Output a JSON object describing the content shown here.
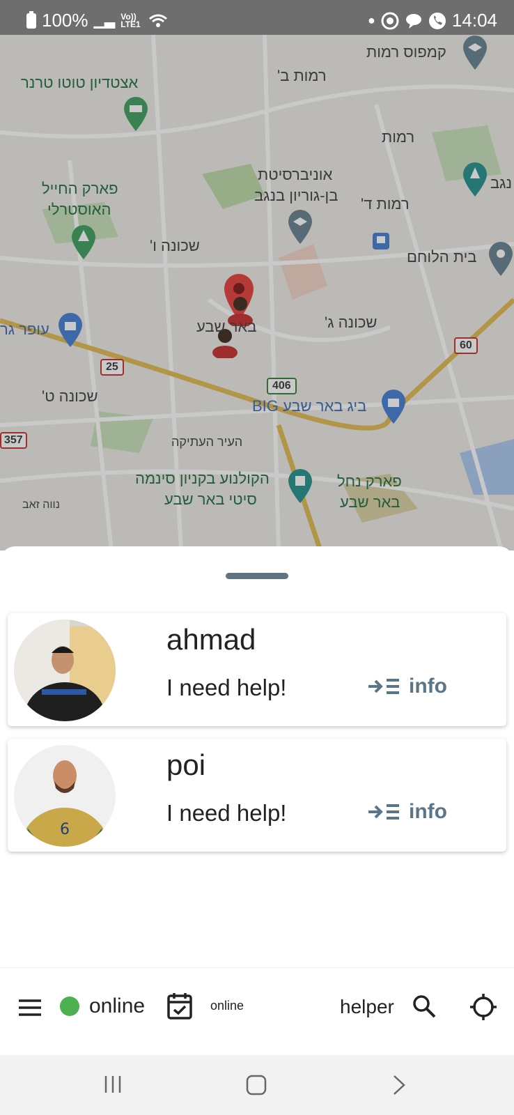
{
  "status_bar": {
    "battery": "100%",
    "signal": "Vo)) LTE1",
    "time": "14:04",
    "icons": [
      "battery-icon",
      "signal-icon",
      "wifi-icon",
      "whatsapp-icon",
      "chat-icon",
      "phone-icon"
    ]
  },
  "map": {
    "labels": [
      {
        "text": "קמפוס רמות",
        "kind": "normal"
      },
      {
        "text": "רמות ב'",
        "kind": "normal"
      },
      {
        "text": "אצטדיון טוטו טרנר",
        "kind": "green"
      },
      {
        "text": "רמות",
        "kind": "normal"
      },
      {
        "text": "אוניברסיטת",
        "kind": "normal"
      },
      {
        "text": "בן-גוריון בנגב",
        "kind": "normal"
      },
      {
        "text": "רמות ד'",
        "kind": "normal"
      },
      {
        "text": "נגב",
        "kind": "normal"
      },
      {
        "text": "פארק החייל",
        "kind": "green"
      },
      {
        "text": "האוסטרלי",
        "kind": "green"
      },
      {
        "text": "שכונה ו'",
        "kind": "normal"
      },
      {
        "text": "בית הלוחם",
        "kind": "normal"
      },
      {
        "text": "באר שבע",
        "kind": "normal"
      },
      {
        "text": "שכונה ג'",
        "kind": "normal"
      },
      {
        "text": "עופר גר",
        "kind": "blue"
      },
      {
        "text": "שכונה ט'",
        "kind": "normal"
      },
      {
        "text": "ביג באר שבע BIG",
        "kind": "blue"
      },
      {
        "text": "העיר העתיקה",
        "kind": "normal"
      },
      {
        "text": "הקולנוע בקניון סינמה",
        "kind": "green"
      },
      {
        "text": "סיטי באר שבע",
        "kind": "green"
      },
      {
        "text": "פארק נחל",
        "kind": "green"
      },
      {
        "text": "באר שבע",
        "kind": "green"
      },
      {
        "text": "נווה זאב",
        "kind": "normal"
      }
    ],
    "road_shields": [
      "25",
      "406",
      "60",
      "357"
    ]
  },
  "sheet": {
    "cards": [
      {
        "name": "ahmad",
        "message": "I need help!",
        "info_label": "info"
      },
      {
        "name": "poi",
        "message": "I need help!",
        "info_label": "info"
      }
    ]
  },
  "bottom_bar": {
    "status_label": "online",
    "status_color": "#4caf50",
    "schedule_label": "online",
    "role_label": "helper"
  }
}
